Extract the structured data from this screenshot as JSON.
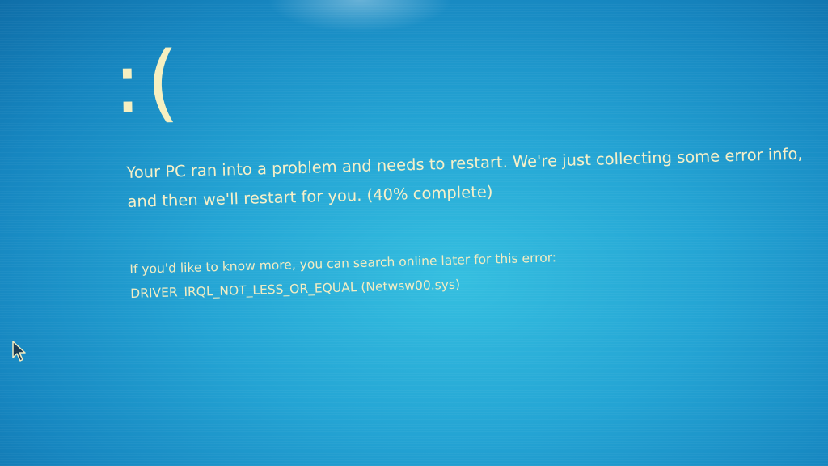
{
  "screen": {
    "sad_face": ":(",
    "message": "Your PC ran into a problem and needs to restart. We're just collecting some error info, and then we'll restart for you. (40% complete)",
    "progress_percent": 40,
    "more_info_line": "If you'd like to know more, you can search online later for this error:",
    "error_code": "DRIVER_IRQL_NOT_LESS_OR_EQUAL (Netwsw00.sys)"
  },
  "colors": {
    "background": "#24a4d4",
    "text": "#f6f0c8"
  },
  "icons": {
    "cursor": "mouse-pointer-icon"
  }
}
